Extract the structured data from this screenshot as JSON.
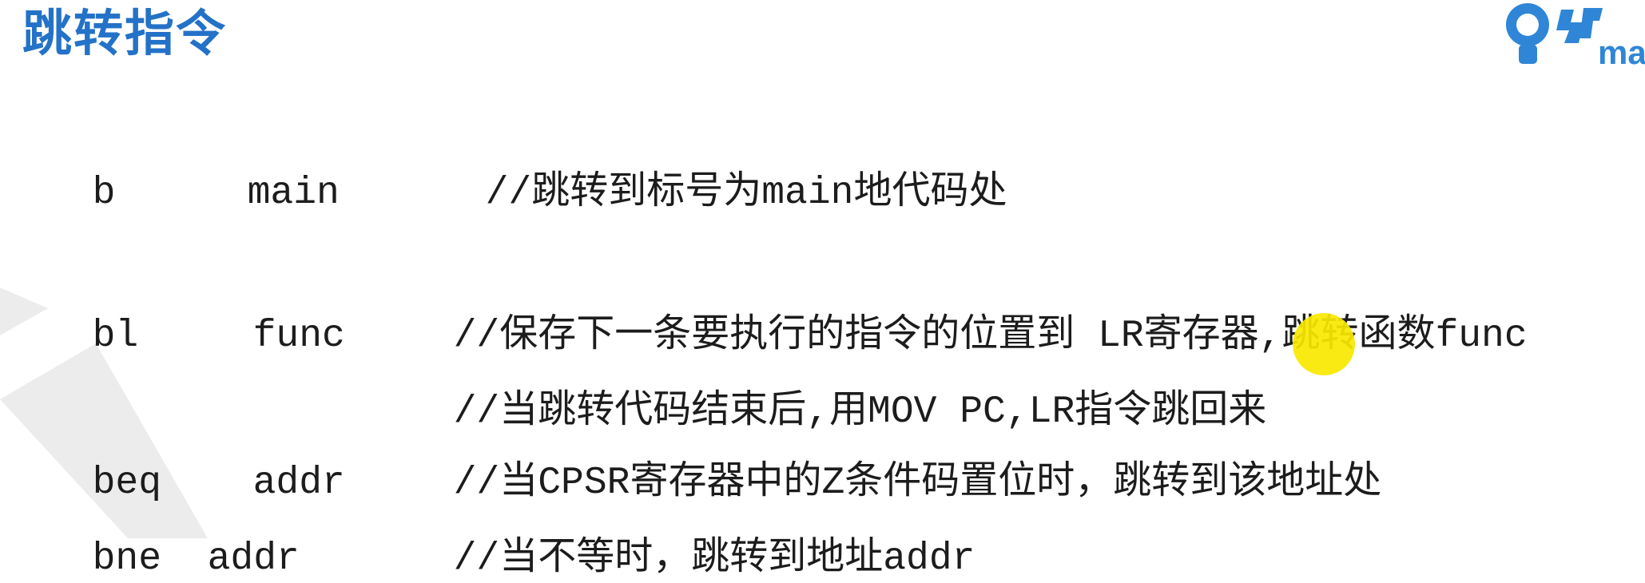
{
  "slide": {
    "title": "跳转指令",
    "logo_text": "ma",
    "colors": {
      "title": "#2472c8",
      "logo": "#2f86d6",
      "background_shape": "#ececec",
      "cursor": "#f8e800"
    },
    "icons": {
      "logo": "lightbulb-logo-icon"
    }
  },
  "code": {
    "lines": [
      {
        "instruction": "b",
        "operand": "main",
        "comment": "//跳转到标号为main地代码处"
      },
      {
        "instruction": "bl",
        "operand": "func",
        "comment": "//保存下一条要执行的指令的位置到 LR寄存器,跳转函数func"
      },
      {
        "instruction": "",
        "operand": "",
        "comment": "//当跳转代码结束后,用MOV PC,LR指令跳回来"
      },
      {
        "instruction": "beq",
        "operand": "addr",
        "comment": "//当CPSR寄存器中的Z条件码置位时，跳转到该地址处"
      },
      {
        "instruction": "bne",
        "operand": "addr",
        "comment": "//当不等时，跳转到地址addr"
      }
    ]
  }
}
